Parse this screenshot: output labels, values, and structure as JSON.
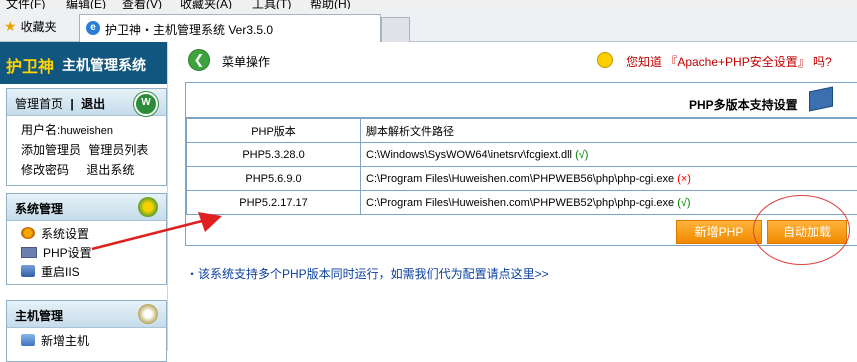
{
  "menubar": {
    "items": [
      "文件(F)",
      "编辑(E)",
      "查看(V)",
      "收藏夹(A)",
      "工具(T)",
      "帮助(H)"
    ]
  },
  "browser": {
    "favorites_label": "收藏夹",
    "tab_title": "护卫神・主机管理系统 Ver3.5.0"
  },
  "sidebar": {
    "logo_brand": "护卫神",
    "logo_title": "主机管理系统",
    "account": {
      "home_link": "管理首页",
      "divider": "|",
      "logout_link": "退出",
      "username_label": "用户名:",
      "username": "huweishen",
      "add_admin": "添加管理员",
      "admin_list": "管理员列表",
      "change_password": "修改密码",
      "exit_system": "退出系统"
    },
    "system_section": {
      "title": "系统管理",
      "items": [
        "系统设置",
        "PHP设置",
        "重启IIS"
      ]
    },
    "host_section": {
      "title": "主机管理",
      "items": [
        "新增主机"
      ]
    }
  },
  "main": {
    "toolbar_label": "菜单操作",
    "tip": "您知道 『Apache+PHP安全设置』 吗?",
    "panel_title": "PHP多版本支持设置",
    "columns": [
      "PHP版本",
      "脚本解析文件路径"
    ],
    "rows": [
      {
        "version": "PHP5.3.28.0",
        "path": "C:\\Windows\\SysWOW64\\inetsrv\\fcgiext.dll",
        "status": "(√)",
        "ok": true
      },
      {
        "version": "PHP5.6.9.0",
        "path": "C:\\Program Files\\Huweishen.com\\PHPWEB56\\php\\php-cgi.exe",
        "status": "(×)",
        "ok": false
      },
      {
        "version": "PHP5.2.17.17",
        "path": "C:\\Program Files\\Huweishen.com\\PHPWEB52\\php\\php-cgi.exe",
        "status": "(√)",
        "ok": true
      }
    ],
    "add_php_button": "新增PHP",
    "auto_load_button": "自动加载",
    "note": "・该系统支持多个PHP版本同时运行，如需我们代为配置请点这里>>"
  }
}
